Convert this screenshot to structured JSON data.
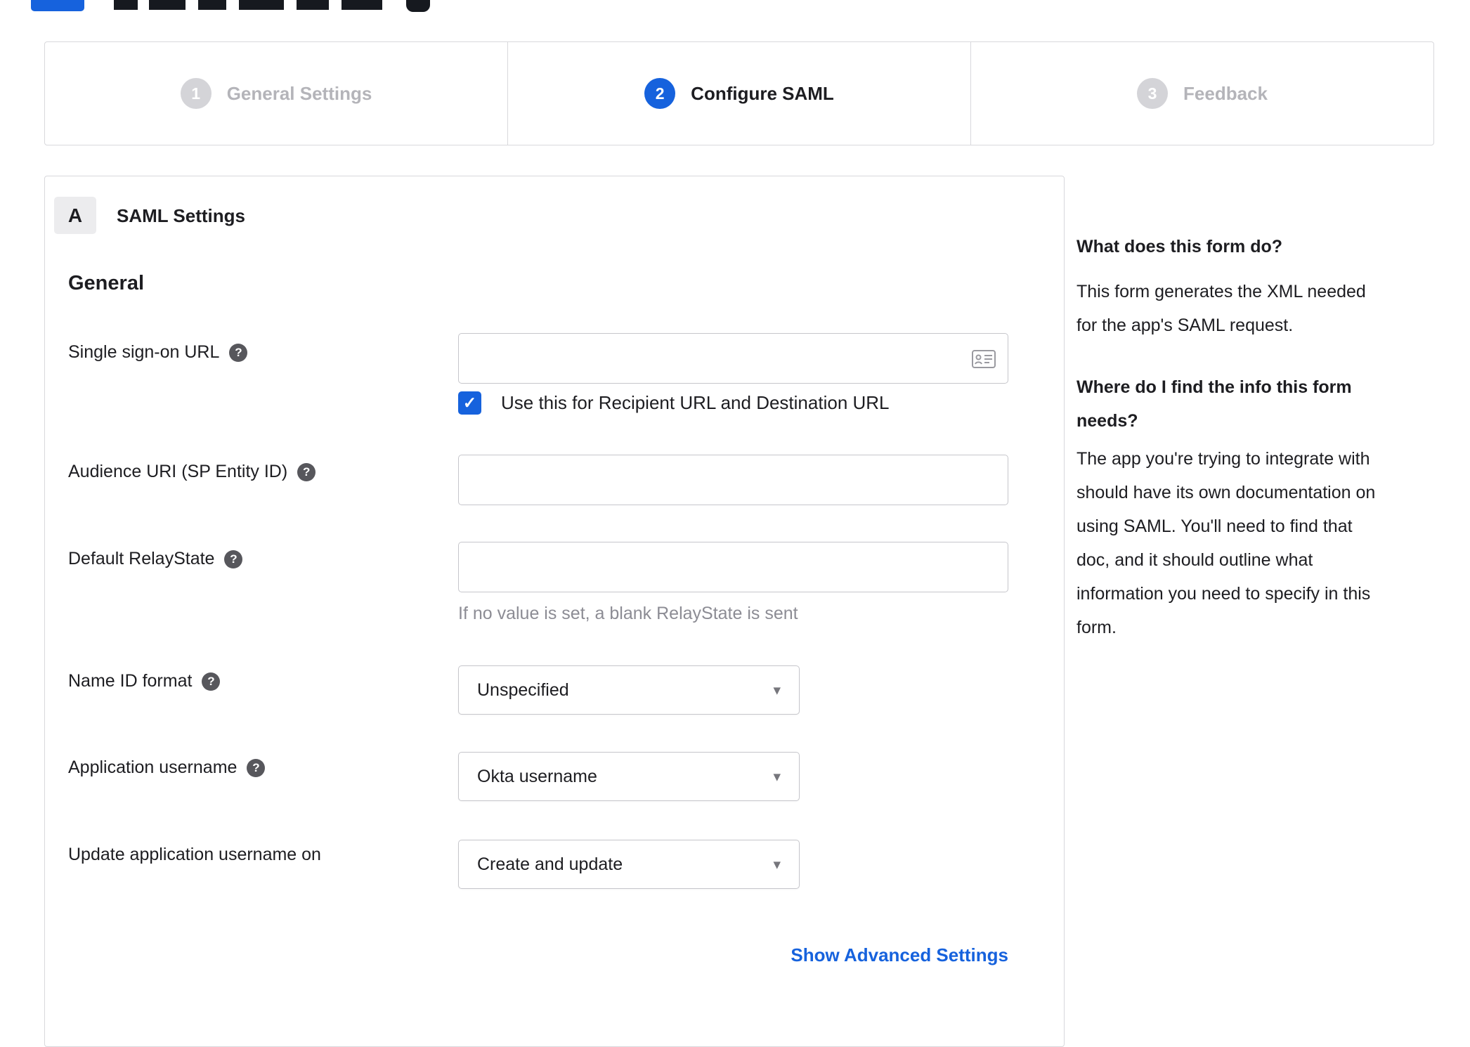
{
  "stepper": {
    "steps": [
      {
        "number": "1",
        "label": "General Settings",
        "state": "inactive"
      },
      {
        "number": "2",
        "label": "Configure SAML",
        "state": "active"
      },
      {
        "number": "3",
        "label": "Feedback",
        "state": "inactive"
      }
    ]
  },
  "panel": {
    "badge": "A",
    "title": "SAML Settings",
    "section": "General",
    "fields": {
      "sso_url": {
        "label": "Single sign-on URL",
        "value": "",
        "checkbox_label": "Use this for Recipient URL and Destination URL",
        "checkbox_checked": true
      },
      "audience_uri": {
        "label": "Audience URI (SP Entity ID)",
        "value": ""
      },
      "relay_state": {
        "label": "Default RelayState",
        "value": "",
        "hint": "If no value is set, a blank RelayState is sent"
      },
      "name_id_format": {
        "label": "Name ID format",
        "value": "Unspecified"
      },
      "app_username": {
        "label": "Application username",
        "value": "Okta username"
      },
      "update_app_username": {
        "label": "Update application username on",
        "value": "Create and update"
      }
    },
    "advanced_link": "Show Advanced Settings"
  },
  "help": {
    "q1": "What does this form do?",
    "a1": "This form generates the XML needed\nfor the app's SAML request.",
    "q2": "Where do I find the info this form\nneeds?",
    "a2": "The app you're trying to integrate with\nshould have its own documentation on\nusing SAML. You'll need to find that\ndoc, and it should outline what\ninformation you need to specify in this\nform."
  },
  "icons": {
    "help_glyph": "?",
    "check_glyph": "✓",
    "caret_glyph": "▾"
  },
  "colors": {
    "accent_blue": "#1662dd",
    "border_gray": "#d8d8dc",
    "input_border": "#c6c6cb",
    "text_dark": "#1d1d21",
    "inactive_gray": "#b4b4b9",
    "hint_gray": "#8c8c94"
  }
}
